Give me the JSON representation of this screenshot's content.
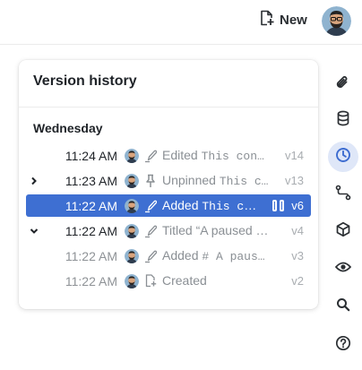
{
  "header": {
    "new_label": "New",
    "icons": [
      "new-document-icon",
      "user-avatar"
    ]
  },
  "panel": {
    "title": "Version history",
    "day_label": "Wednesday",
    "rows": [
      {
        "time": "11:24 AM",
        "action_icon": "pencil-icon",
        "desc_prefix": "Edited ",
        "desc_mono": "This con…",
        "version": "v14",
        "chevron": "",
        "selected": false,
        "dim": false
      },
      {
        "time": "11:23 AM",
        "action_icon": "pin-icon",
        "desc_prefix": "Unpinned ",
        "desc_mono": "This c…",
        "version": "v13",
        "chevron": "right",
        "selected": false,
        "dim": false
      },
      {
        "time": "11:22 AM",
        "action_icon": "pencil-icon",
        "desc_prefix": "Added ",
        "desc_mono": "This con…",
        "version": "v6",
        "chevron": "",
        "selected": true,
        "dim": false
      },
      {
        "time": "11:22 AM",
        "action_icon": "pencil-icon",
        "desc_prefix": "Titled “A paused …",
        "desc_mono": "",
        "version": "v4",
        "chevron": "down",
        "selected": false,
        "dim": false
      },
      {
        "time": "11:22 AM",
        "action_icon": "pencil-icon",
        "desc_prefix": "Added ",
        "desc_mono": "# A paus…",
        "version": "v3",
        "chevron": "",
        "selected": false,
        "dim": true
      },
      {
        "time": "11:22 AM",
        "action_icon": "new-document-icon",
        "desc_prefix": "Created",
        "desc_mono": "",
        "version": "v2",
        "chevron": "",
        "selected": false,
        "dim": true
      }
    ]
  },
  "rail": {
    "icons": [
      "paperclip-icon",
      "database-icon",
      "clock-icon",
      "route-icon",
      "cube-icon",
      "eye-icon",
      "search-icon",
      "help-icon"
    ],
    "active": "clock-icon"
  },
  "colors": {
    "selected_row": "#3e6fd2",
    "active_rail_bg": "#dfe7f8",
    "active_rail_icon": "#3d6cd0"
  }
}
